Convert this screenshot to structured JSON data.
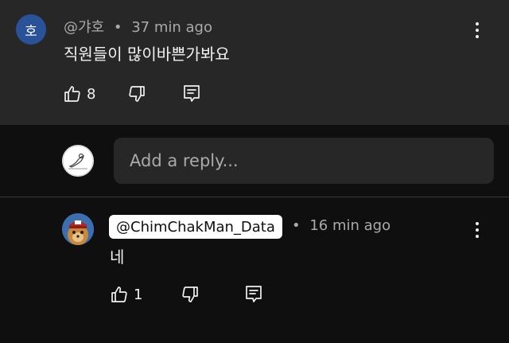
{
  "comment": {
    "avatar_letter": "호",
    "author": "@갸호",
    "separator": "•",
    "time": "37 min ago",
    "text": "직원들이 많이바쁜가봐요",
    "likes": "8"
  },
  "reply_box": {
    "placeholder": "Add a reply..."
  },
  "reply": {
    "mention": "@ChimChakMan_Data",
    "separator": "•",
    "time": "16 min ago",
    "text": "네",
    "likes": "1"
  },
  "colors": {
    "top_background": "#272727",
    "page_background": "#0f0f0f",
    "avatar_blue": "#2a5298",
    "muted_text": "#aaaaaa"
  },
  "icons": [
    "thumbs-up-icon",
    "thumbs-down-icon",
    "reply-icon",
    "more-vertical-icon"
  ]
}
